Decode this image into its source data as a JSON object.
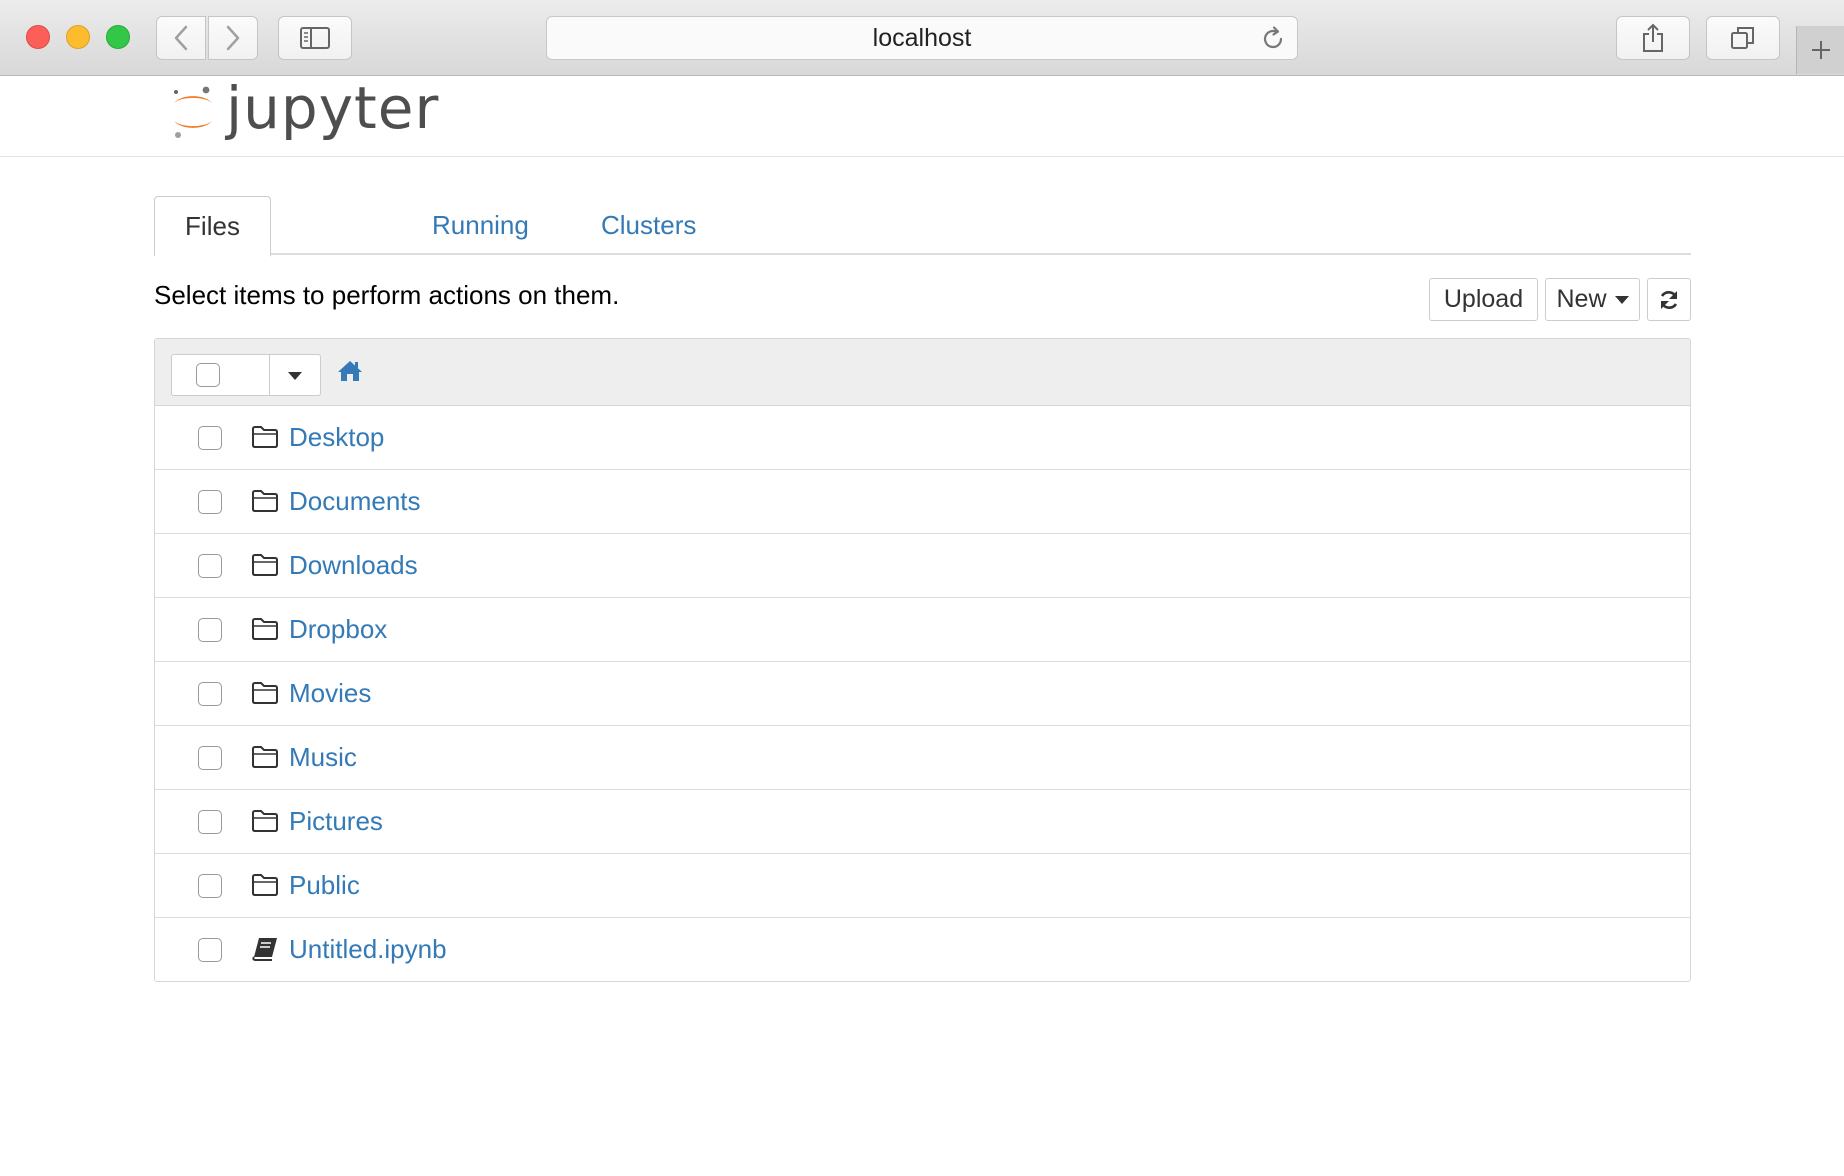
{
  "browser": {
    "address": "localhost"
  },
  "header": {
    "logo_text": "jupyter"
  },
  "tabs": [
    {
      "label": "Files",
      "active": true
    },
    {
      "label": "Running",
      "active": false
    },
    {
      "label": "Clusters",
      "active": false
    }
  ],
  "toolbar": {
    "hint": "Select items to perform actions on them.",
    "upload_label": "Upload",
    "new_label": "New"
  },
  "files": [
    {
      "name": "Desktop",
      "type": "folder",
      "icon": "folder-icon"
    },
    {
      "name": "Documents",
      "type": "folder",
      "icon": "folder-icon"
    },
    {
      "name": "Downloads",
      "type": "folder",
      "icon": "folder-icon"
    },
    {
      "name": "Dropbox",
      "type": "folder",
      "icon": "folder-icon"
    },
    {
      "name": "Movies",
      "type": "folder",
      "icon": "folder-icon"
    },
    {
      "name": "Music",
      "type": "folder",
      "icon": "folder-icon"
    },
    {
      "name": "Pictures",
      "type": "folder",
      "icon": "folder-icon"
    },
    {
      "name": "Public",
      "type": "folder",
      "icon": "folder-icon"
    },
    {
      "name": "Untitled.ipynb",
      "type": "notebook",
      "icon": "notebook-icon"
    }
  ],
  "colors": {
    "link": "#337ab7",
    "logo_orange": "#f37726"
  }
}
